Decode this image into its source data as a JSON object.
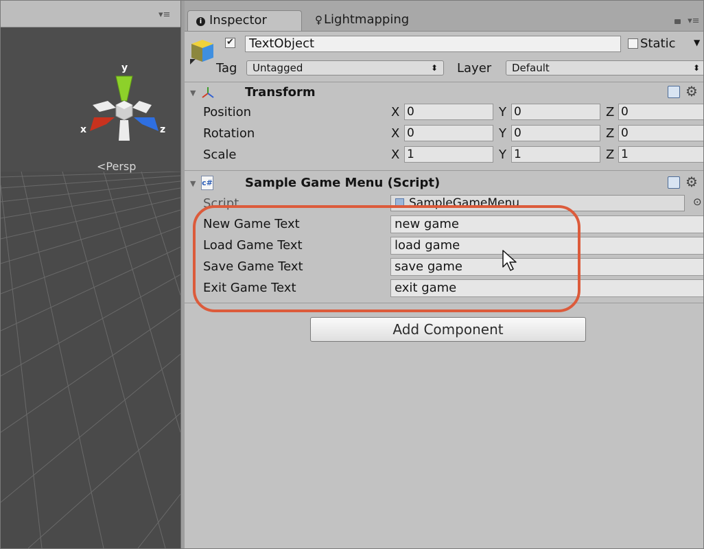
{
  "scene": {
    "menu_glyph": "▾≡",
    "persp_label": "Persp",
    "gizmo": {
      "y_label": "y",
      "x_label": "x",
      "z_label": "z"
    }
  },
  "tabs": [
    {
      "label": "Inspector",
      "icon": "info-icon"
    },
    {
      "label": "Lightmapping",
      "icon": "lightbulb-icon"
    }
  ],
  "tab_menu_glyph": "▾≡",
  "object": {
    "active": true,
    "name": "TextObject",
    "static_label": "Static",
    "static": false,
    "tag_label": "Tag",
    "tag_value": "Untagged",
    "layer_label": "Layer",
    "layer_value": "Default"
  },
  "transform": {
    "title": "Transform",
    "rows": [
      {
        "label": "Position",
        "x": "0",
        "y": "0",
        "z": "0"
      },
      {
        "label": "Rotation",
        "x": "0",
        "y": "0",
        "z": "0"
      },
      {
        "label": "Scale",
        "x": "1",
        "y": "1",
        "z": "1"
      }
    ],
    "axis_labels": {
      "x": "X",
      "y": "Y",
      "z": "Z"
    }
  },
  "script_component": {
    "title": "Sample Game Menu (Script)",
    "script_label": "Script",
    "script_value": "SampleGameMenu",
    "fields": [
      {
        "label": "New Game Text",
        "value": "new game"
      },
      {
        "label": "Load Game Text",
        "value": "load game"
      },
      {
        "label": "Save Game Text",
        "value": "save game"
      },
      {
        "label": "Exit Game Text",
        "value": "exit game"
      }
    ]
  },
  "add_component_label": "Add Component",
  "colors": {
    "highlight": "#dc5b3b",
    "panel_bg": "#c2c2c2",
    "scene_bg": "#4a4a4a",
    "axis_x": "#c8321e",
    "axis_y": "#8dd12a",
    "axis_z": "#2f6fe0"
  }
}
